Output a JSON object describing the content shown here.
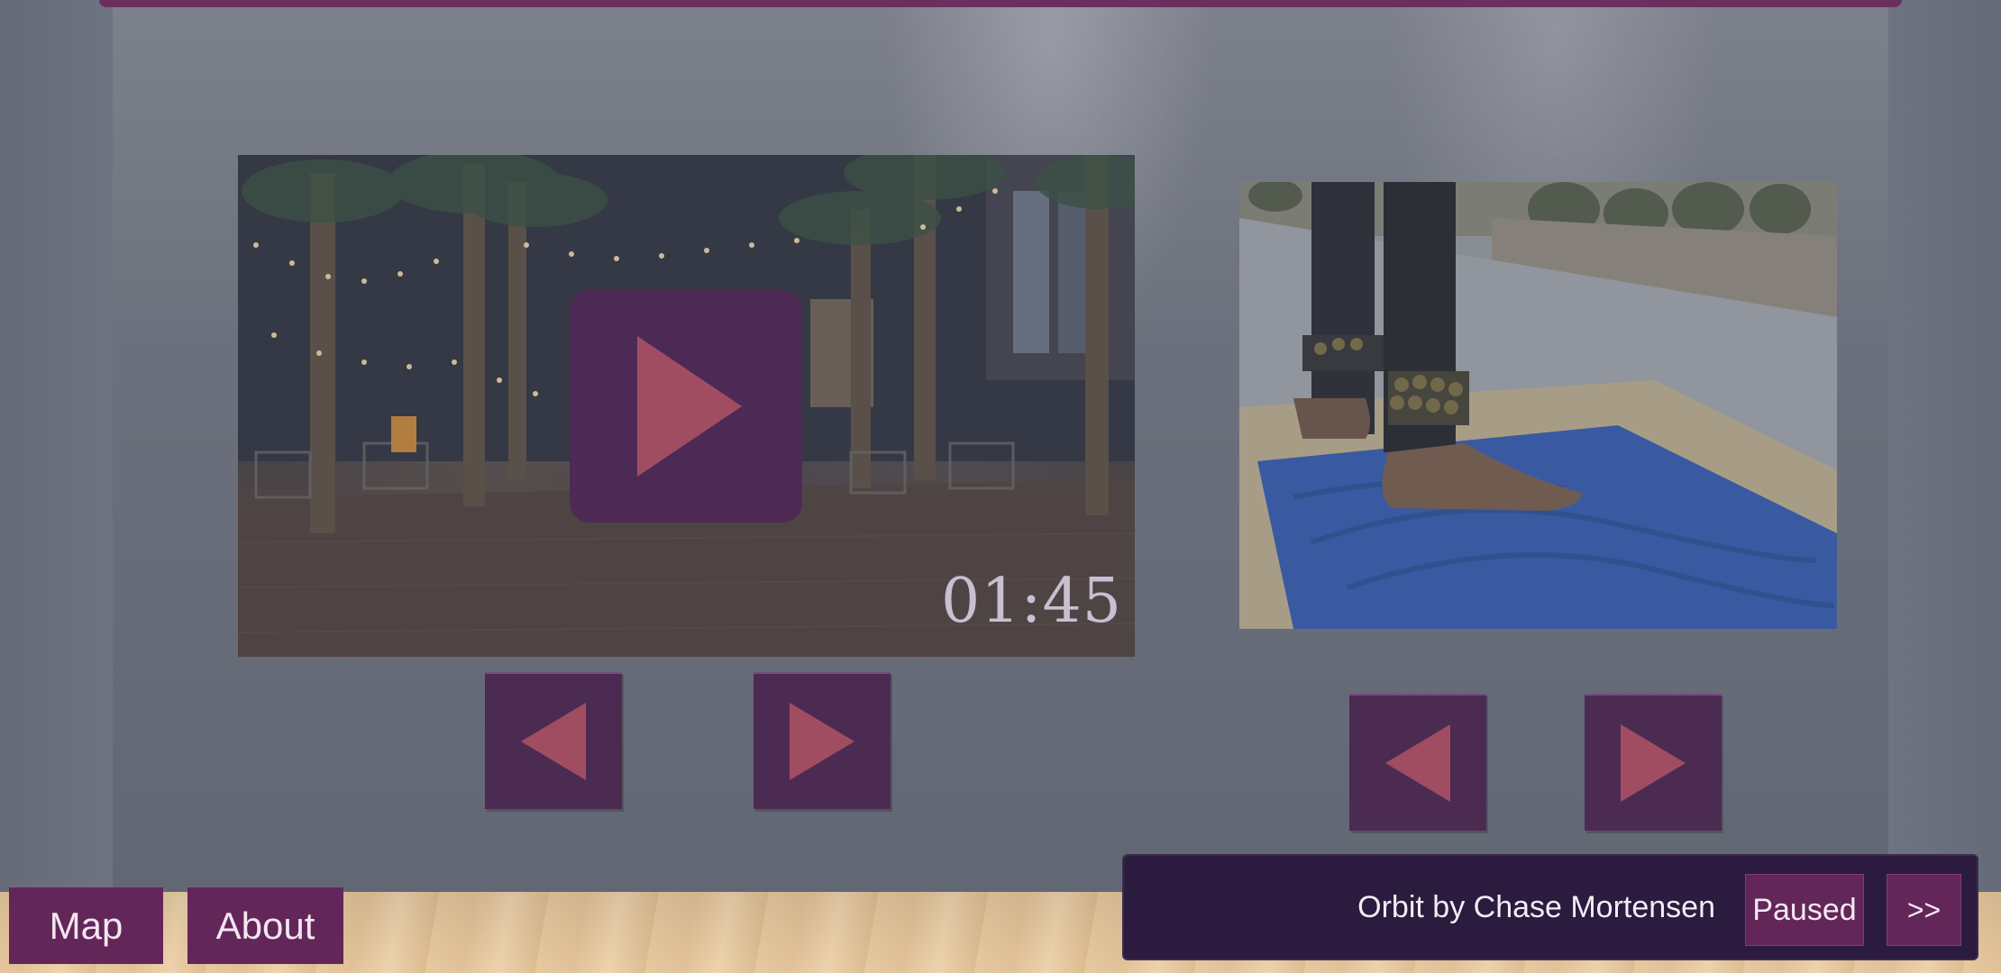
{
  "gallery": {
    "video": {
      "timestamp": "01:45",
      "play_icon": "play-icon"
    },
    "video_nav": {
      "prev_icon": "arrow-left-icon",
      "next_icon": "arrow-right-icon"
    },
    "photo_nav": {
      "prev_icon": "arrow-left-icon",
      "next_icon": "arrow-right-icon"
    }
  },
  "nav": {
    "map_label": "Map",
    "about_label": "About"
  },
  "music": {
    "track": "Orbit by Chase Mortensen",
    "status_label": "Paused",
    "skip_label": ">>"
  },
  "colors": {
    "accent": "#632659",
    "panel_button": "#4b2b52",
    "arrow": "#a04d62",
    "music_bar": "#2b1b3e"
  }
}
